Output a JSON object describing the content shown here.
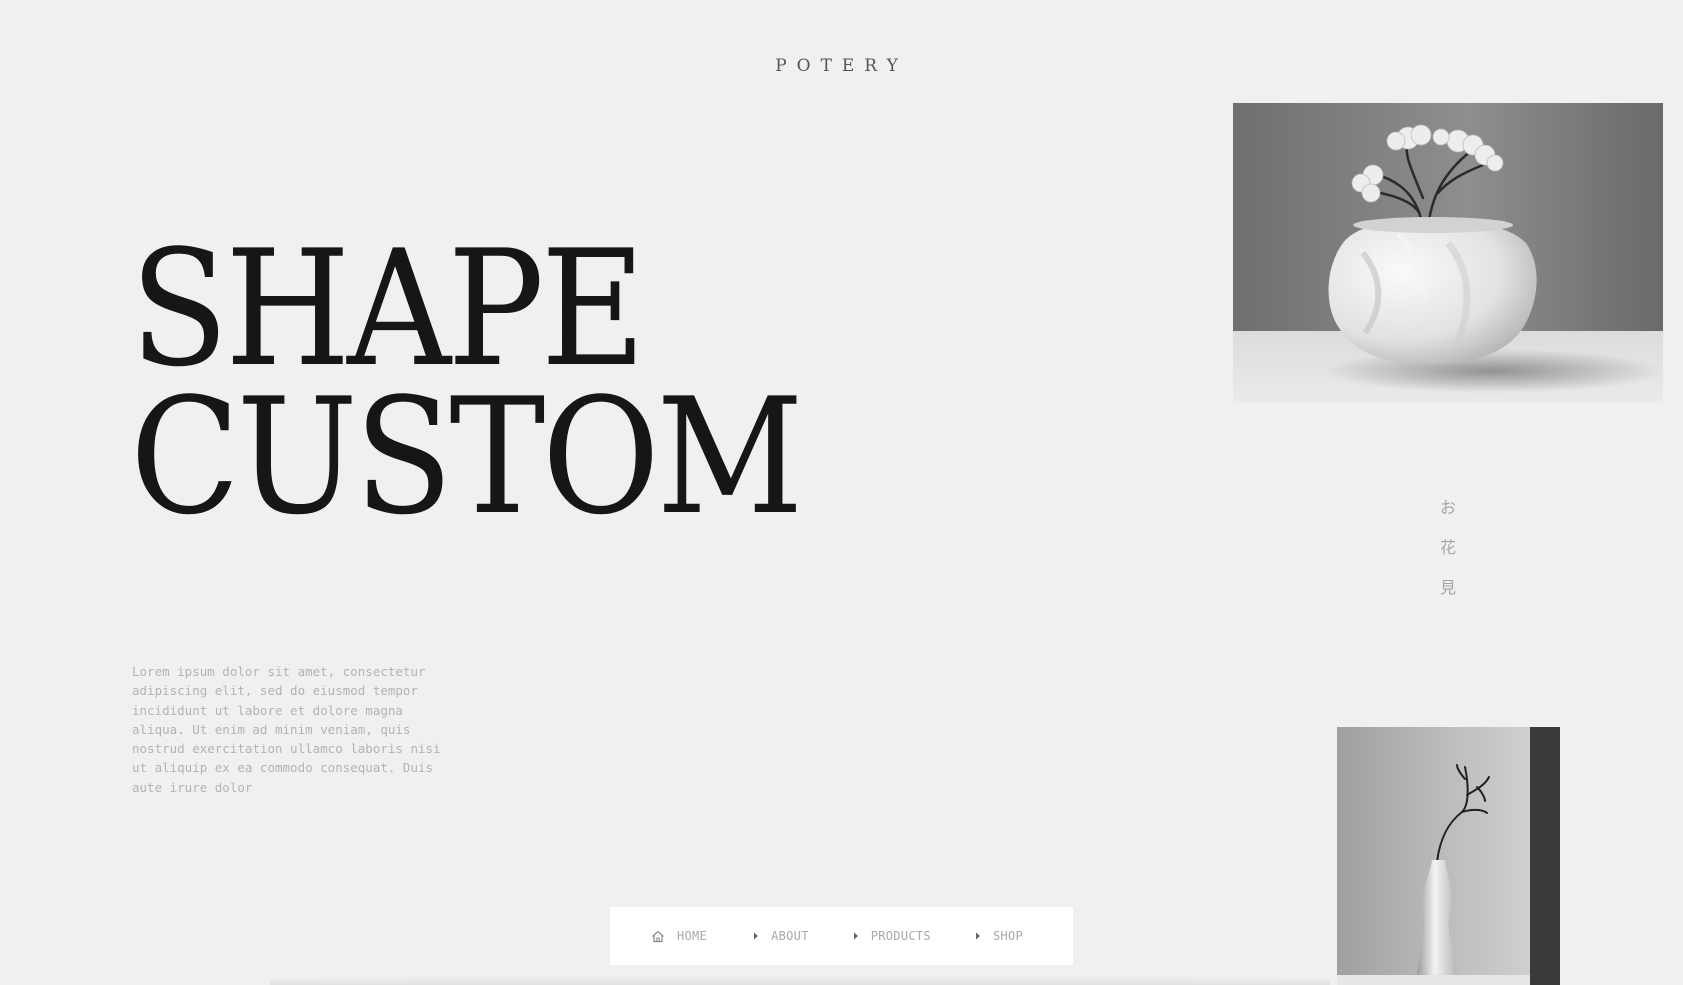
{
  "brand": {
    "name": "POTERY"
  },
  "hero": {
    "line1": "SHAPE",
    "line2": "CUSTOM"
  },
  "description": "Lorem ipsum dolor sit amet, consectetur adipiscing elit, sed do eiusmod tempor incididunt ut labore et dolore magna aliqua. Ut enim ad minim veniam, quis nostrud exercitation ullamco laboris nisi ut aliquip ex ea commodo consequat. Duis aute irure dolor",
  "vertical_text": [
    "お",
    "花",
    "見"
  ],
  "nav": {
    "items": [
      {
        "label": "HOME",
        "icon": "home-icon"
      },
      {
        "label": "ABOUT",
        "icon": "caret-right-icon"
      },
      {
        "label": "PRODUCTS",
        "icon": "caret-right-icon"
      },
      {
        "label": "SHOP",
        "icon": "caret-right-icon"
      }
    ]
  },
  "colors": {
    "background": "#f0f0f0",
    "heading": "#161616",
    "muted_text": "#b3b3b3",
    "nav_background": "#ffffff"
  }
}
